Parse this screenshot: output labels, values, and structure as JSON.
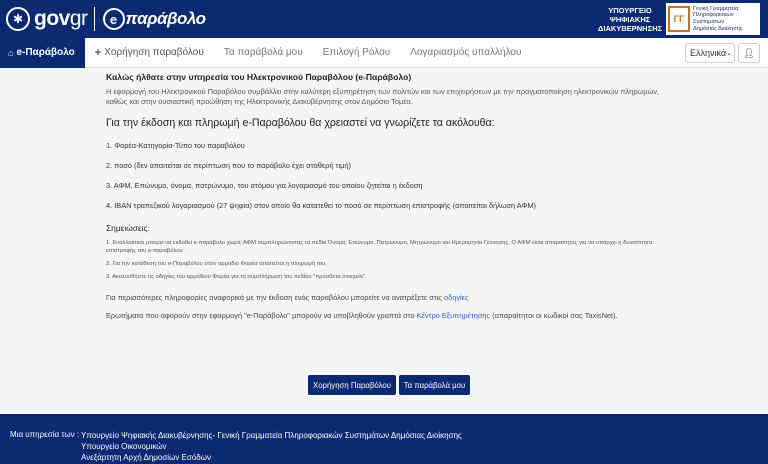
{
  "header": {
    "gov_logo_text": "gov",
    "gov_logo_suffix": "gr",
    "app_logo_text": "παράβολο",
    "ministry_lines": [
      "ΥΠΟΥΡΓΕΙΟ",
      "ΨΗΦΙΑΚΗΣ",
      "ΔΙΑΚΥΒΕΡΝΗΣΗΣ"
    ],
    "gsis_lines": [
      "Γενική Γραμματεία",
      "Πληροφοριακών",
      "Συστημάτων",
      "Δημόσιας Διοίκησης"
    ]
  },
  "nav": {
    "items": [
      {
        "label": "e-Παράβολο",
        "icon": "home-icon",
        "active": true
      },
      {
        "label": "Χορήγηση παραβόλου",
        "icon": "plus-icon",
        "active": false
      },
      {
        "label": "Τα παράβολά μου",
        "active": false
      },
      {
        "label": "Επιλογή Ρόλου",
        "active": false
      },
      {
        "label": "Λογαριασμός υπαλλήλου",
        "active": false
      }
    ],
    "language": "Ελληνικά",
    "user_icon": "user-icon"
  },
  "content": {
    "welcome": "Καλώς ήλθατε στην υπηρεσία του Ηλεκτρονικού Παραβόλου (e-Παράβολο)",
    "intro": "Η εφαρμογή του Ηλεκτρονικού Παραβόλου συμβάλλει στην καλύτερη εξυπηρέτηση των πολιτών και των επιχειρήσεων με την πραγματοποίηση ηλεκτρονικών πληρωμών, καθώς και στην ουσιαστική προώθηση της Ηλεκτρονικής Διακυβέρνησης στον Δημόσιο Τομέα.",
    "heading": "Για την έκδοση και πληρωμή e-Παραβόλου θα χρειαστεί να γνωρίζετε τα ακόλουθα:",
    "requirements": [
      "1. Φορέα-Κατηγορία-Τύπο του παραβόλου",
      "2. ποσό (δεν απαιτείται σε περίπτωση που το παράβολο έχει σταθερή τιμή)",
      "3. ΑΦΜ, Επώνυμο, όνομα, πατρώνυμο, του ατόμου για λογαριασμό του οποίου ζητείται η έκδοση",
      "4. IBAN τραπεζικού λογαριασμού (27 ψηφία) στον οποίο θα κατατεθεί το ποσό σε περίπτωση επιστροφής (απαιτείται δήλωση ΑΦΜ)"
    ],
    "notes_title": "Σημειώσεις:",
    "notes": [
      "1. Εναλλακτικά μπορεί να εκδοθεί e-παράβολο χωρίς ΑΦΜ συμπληρώνοντας τα πεδία Όνομα, Επώνυμο, Πατρώνυμο, Μητρώνυμο και Ημερομηνία Γέννησης. Ο ΑΦΜ είναι απαραίτητος για να υπάρχει η δυνατότητα επιστροφής του e-παραβόλου",
      "2. Για την κατάθεση του e-Παραβόλου στον αρμόδιο Φορέα απαιτείται η πληρωμή του.",
      "3. Ακολουθήστε τις οδηγίες του αρμόδιου Φορέα για τη συμπλήρωση του πεδίου \"πρόσθετα στοιχεία\"."
    ],
    "info1_text": "Για περισσότερες πληροφορίες αναφορικά με την έκδοση ενός παραβόλου μπορείτε να ανατρέξετε στις ",
    "info1_link": "οδηγίες",
    "info2_text": "Ερωτήματα που αφορούν στην εφαρμογή \"e-Παράβολο\" μπορούν να υποβληθούν γραπτά στο ",
    "info2_link": "Κέντρο Εξυπηρέτησης",
    "info2_suffix": " (απαραίτητοι οι κωδικοί σας TaxisNet).",
    "buttons": {
      "issue": "Χορήγηση Παραβόλου",
      "mine": "Τα παράβολά μου"
    }
  },
  "footer": {
    "label": "Μια υπηρεσία των :",
    "lines": [
      "Υπουργείο Ψηφιακής Διακυβέρνησης- Γενική Γραμματεία Πληροφοριακών Συστημάτων Δημόσιας Διοίκησης",
      "Υπουργείο Οικονομικών",
      "Ανεξάρτητη Αρχή Δημοσίων Εσόδων"
    ]
  },
  "colors": {
    "primary": "#0c2a72",
    "link": "#2a5bd7",
    "background": "#f4f5f7"
  }
}
